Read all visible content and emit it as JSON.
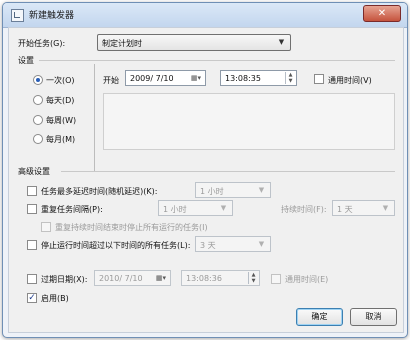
{
  "window": {
    "title": "新建触发器",
    "close_icon": "close-icon"
  },
  "begin_task": {
    "label": "开始任务(G):",
    "value": "制定计划时"
  },
  "settings": {
    "header": "设置",
    "radios": [
      {
        "label": "一次(O)",
        "checked": true
      },
      {
        "label": "每天(D)",
        "checked": false
      },
      {
        "label": "每周(W)",
        "checked": false
      },
      {
        "label": "每月(M)",
        "checked": false
      }
    ],
    "start_label": "开始",
    "start_date": "2009/ 7/10",
    "start_time": "13:08:35",
    "universal_time_label": "通用时间(V)"
  },
  "advanced": {
    "header": "高级设置",
    "delay_label": "任务最多延迟时间(随机延迟)(K):",
    "delay_value": "1 小时",
    "repeat_label": "重复任务间隔(P):",
    "repeat_value": "1 小时",
    "duration_label": "持续时间(F):",
    "duration_value": "1 天",
    "stop_all_label": "重复持续时间结束时停止所有运行的任务(I)",
    "stop_longer_label": "停止运行时间超过以下时间的所有任务(L):",
    "stop_longer_value": "3 天",
    "expire_label": "过期日期(X):",
    "expire_date": "2010/ 7/10",
    "expire_time": "13:08:36",
    "expire_universal_label": "通用时间(E)",
    "enabled_label": "启用(B)",
    "enabled_checked": true
  },
  "buttons": {
    "ok": "确定",
    "cancel": "取消"
  }
}
